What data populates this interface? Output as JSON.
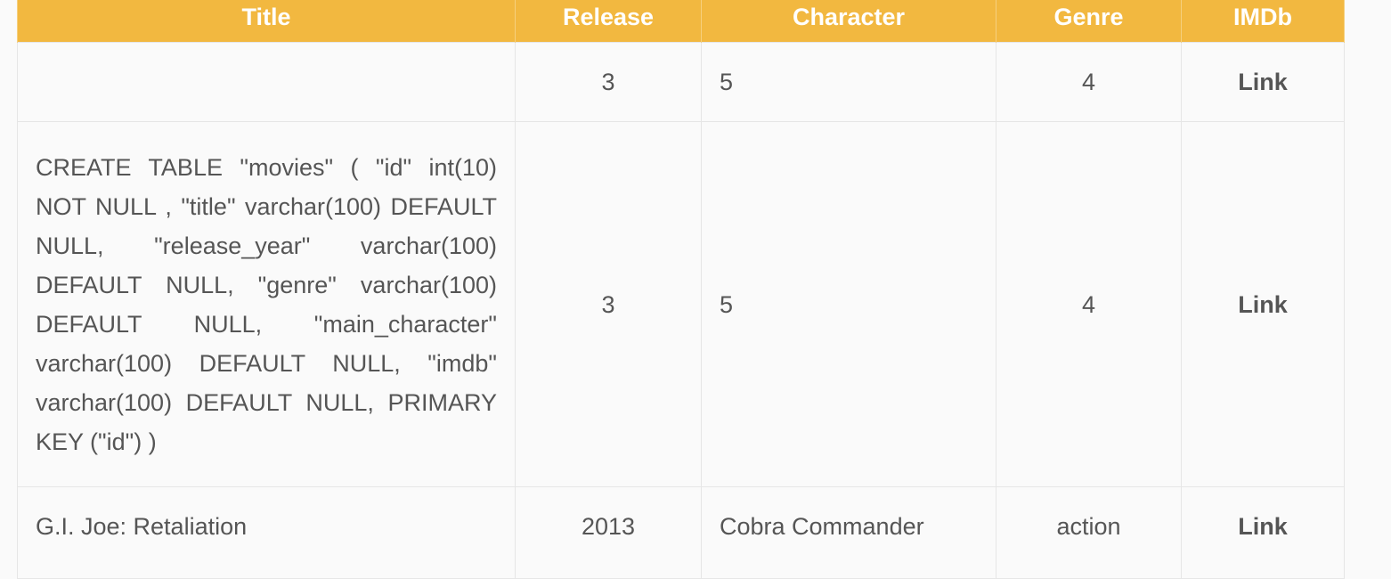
{
  "table": {
    "headers": {
      "title": "Title",
      "release": "Release",
      "character": "Character",
      "genre": "Genre",
      "imdb": "IMDb"
    },
    "rows": [
      {
        "title": "",
        "release": "3",
        "character": "5",
        "genre": "4",
        "imdb": "Link"
      },
      {
        "title": "CREATE TABLE \"movies\" ( \"id\" int(10) NOT NULL , \"title\" varchar(100) DEFAULT NULL, \"release_year\" varchar(100) DEFAULT NULL, \"genre\" varchar(100) DEFAULT NULL, \"main_character\" varchar(100) DEFAULT NULL, \"imdb\" varchar(100) DEFAULT NULL, PRIMARY KEY (\"id\") )",
        "release": "3",
        "character": "5",
        "genre": "4",
        "imdb": "Link"
      },
      {
        "title": "G.I. Joe: Retaliation",
        "release": "2013",
        "character": "Cobra Commander",
        "genre": "action",
        "imdb": "Link"
      }
    ]
  }
}
